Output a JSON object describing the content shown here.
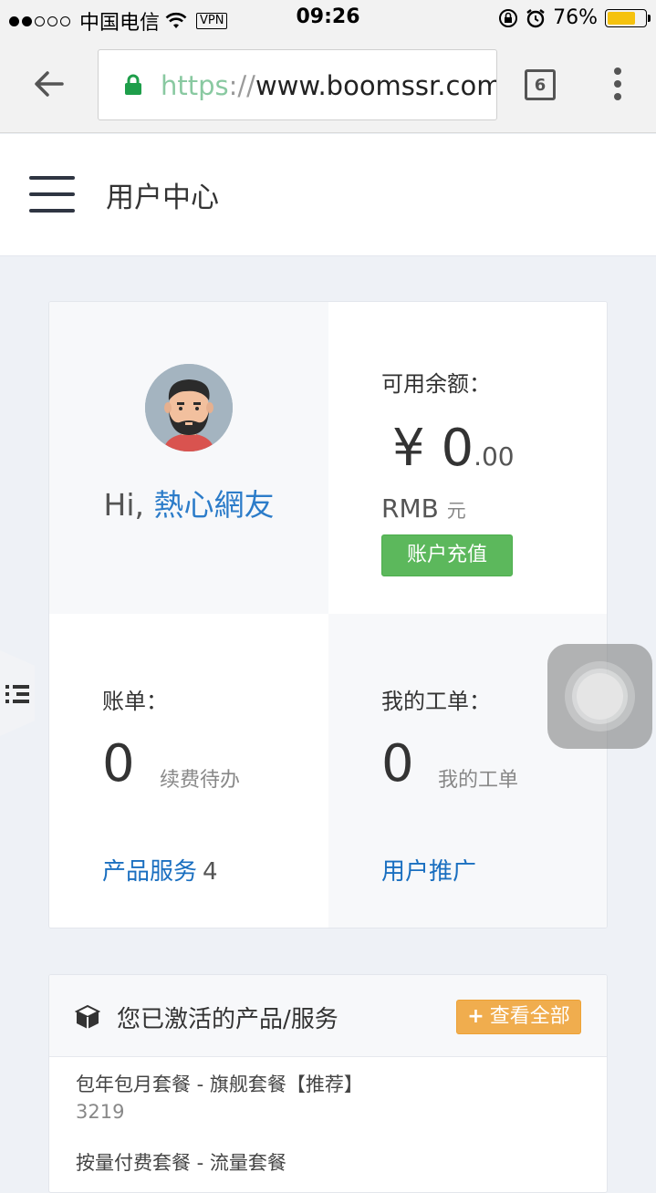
{
  "status_bar": {
    "carrier": "中国电信",
    "vpn": "VPN",
    "time": "09:26",
    "battery": "76%",
    "battery_color": "#f5c20e"
  },
  "browser": {
    "url_scheme": "https",
    "url_sep": "://",
    "url_host": "www.boomssr.com",
    "tab_count": "6"
  },
  "header": {
    "title": "用户中心"
  },
  "profile": {
    "greeting": "Hi, ",
    "username": "熱心網友"
  },
  "balance": {
    "label": "可用余额：",
    "currency": "¥ ",
    "amount": "0",
    "cents": ".00",
    "unit": "RMB",
    "unit_cn": "元",
    "recharge_label": "账户充值"
  },
  "bills": {
    "label": "账单：",
    "count": "0",
    "sub": "续费待办",
    "link": "产品服务",
    "link_count": "4"
  },
  "tickets": {
    "label": "我的工单：",
    "count": "0",
    "sub": "我的工单",
    "link": "用户推广"
  },
  "products": {
    "title": "您已激活的产品/服务",
    "view_all": "查看全部",
    "items": [
      {
        "name": "包年包月套餐 - 旗舰套餐【推荐】",
        "id": "3219"
      },
      {
        "name": "按量付费套餐 - 流量套餐",
        "id": ""
      }
    ]
  },
  "colors": {
    "accent_link": "#1a6fc0",
    "recharge_green": "#5cb85c",
    "view_all_orange": "#f0ad4e"
  }
}
